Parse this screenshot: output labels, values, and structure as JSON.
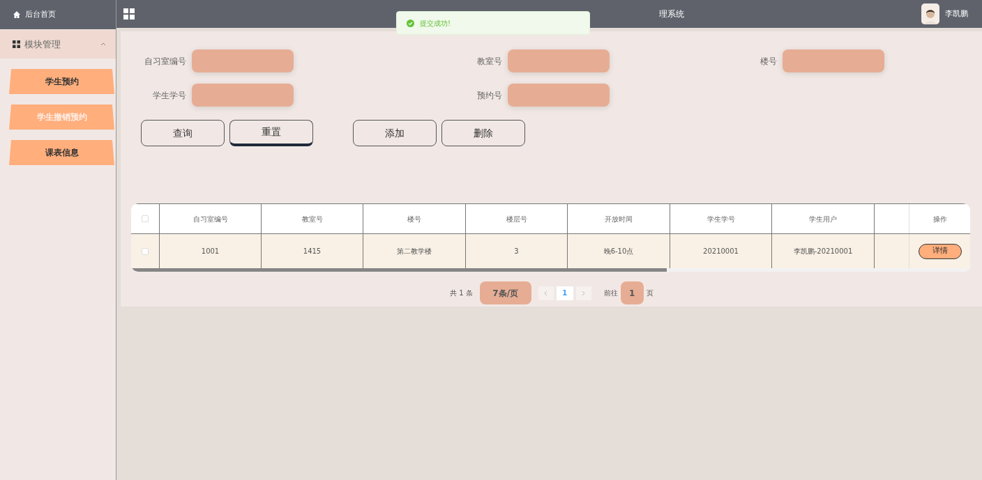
{
  "sidebar": {
    "home": "后台首页",
    "group": {
      "label": "模块管理",
      "expanded": true
    },
    "items": [
      {
        "label": "学生预约",
        "selected": false
      },
      {
        "label": "学生撤销预约",
        "selected": true
      },
      {
        "label": "课表信息",
        "selected": false
      }
    ]
  },
  "header": {
    "title": "理系统",
    "user": "李凯鹏"
  },
  "toast": {
    "message": "提交成功!"
  },
  "search": {
    "fields": [
      {
        "label": "自习室编号"
      },
      {
        "label": "教室号"
      },
      {
        "label": "楼号"
      },
      {
        "label": "学生学号"
      },
      {
        "label": "预约号"
      }
    ],
    "buttons": [
      {
        "label": "查询",
        "highlighted": false
      },
      {
        "label": "重置",
        "highlighted": true
      }
    ],
    "actions": [
      {
        "label": "添加"
      },
      {
        "label": "删除"
      }
    ]
  },
  "table": {
    "all_checked": false,
    "columns": [
      "自习室编号",
      "教室号",
      "楼号",
      "楼层号",
      "开放时间",
      "学生学号",
      "学生用户",
      "操作"
    ],
    "rows": [
      {
        "checked": false,
        "cells": [
          "1001",
          "1415",
          "第二教学楼",
          "3",
          "晚6-10点",
          "20210001",
          "李凯鹏-20210001"
        ],
        "action": "详情"
      }
    ]
  },
  "pagination": {
    "total": "共 1 条",
    "page_size": "7条/页",
    "pages": [
      {
        "label": "1",
        "selected": true
      }
    ],
    "goto_label": "前往",
    "goto_value": "1",
    "goto_suffix": "页"
  }
}
